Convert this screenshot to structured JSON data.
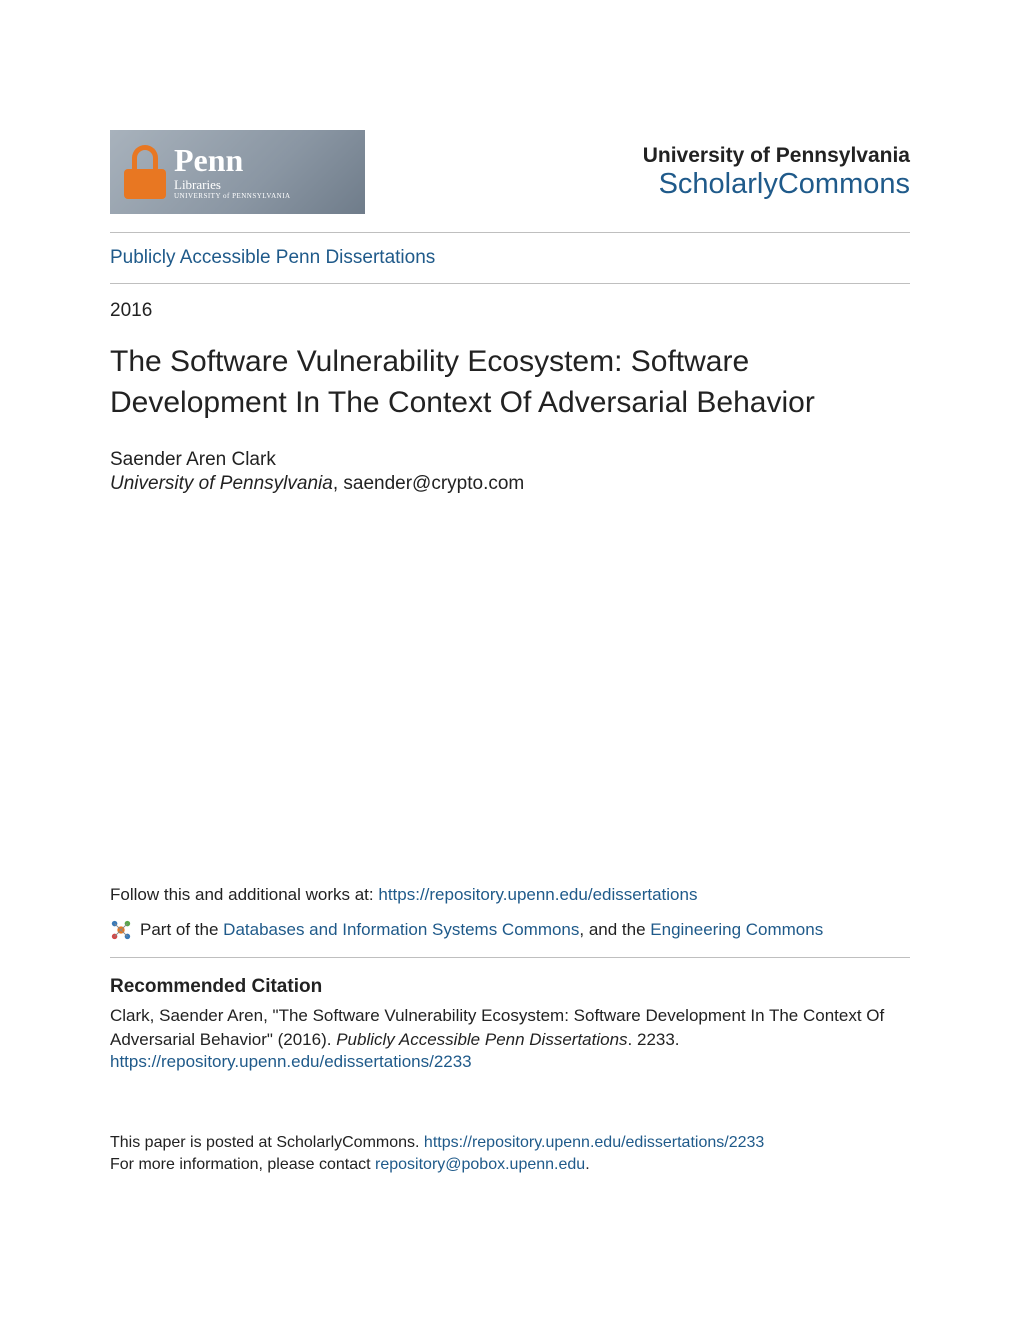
{
  "header": {
    "logo": {
      "main": "Penn",
      "sub": "Libraries",
      "tiny": "UNIVERSITY of PENNSYLVANIA"
    },
    "university": "University of Pennsylvania",
    "site_name": "ScholarlyCommons"
  },
  "nav": {
    "collection": "Publicly Accessible Penn Dissertations"
  },
  "item": {
    "year": "2016",
    "title": "The Software Vulnerability Ecosystem: Software Development In The Context Of Adversarial Behavior",
    "author": "Saender Aren Clark",
    "affiliation_institution": "University of Pennsylvania",
    "affiliation_email": ", saender@crypto.com"
  },
  "follow": {
    "label": "Follow this and additional works at: ",
    "url": "https://repository.upenn.edu/edissertations"
  },
  "partof": {
    "prefix": "Part of the ",
    "link1": "Databases and Information Systems Commons",
    "middle": ", and the ",
    "link2": "Engineering Commons"
  },
  "citation": {
    "heading": "Recommended Citation",
    "text_1": "Clark, Saender Aren, \"The Software Vulnerability Ecosystem: Software Development In The Context Of Adversarial Behavior\" (2016). ",
    "series": "Publicly Accessible Penn Dissertations",
    "text_2": ". 2233.",
    "url": "https://repository.upenn.edu/edissertations/2233"
  },
  "footer": {
    "posted_prefix": "This paper is posted at ScholarlyCommons. ",
    "posted_url": "https://repository.upenn.edu/edissertations/2233",
    "contact_prefix": "For more information, please contact ",
    "contact_email": "repository@pobox.upenn.edu",
    "contact_suffix": "."
  }
}
